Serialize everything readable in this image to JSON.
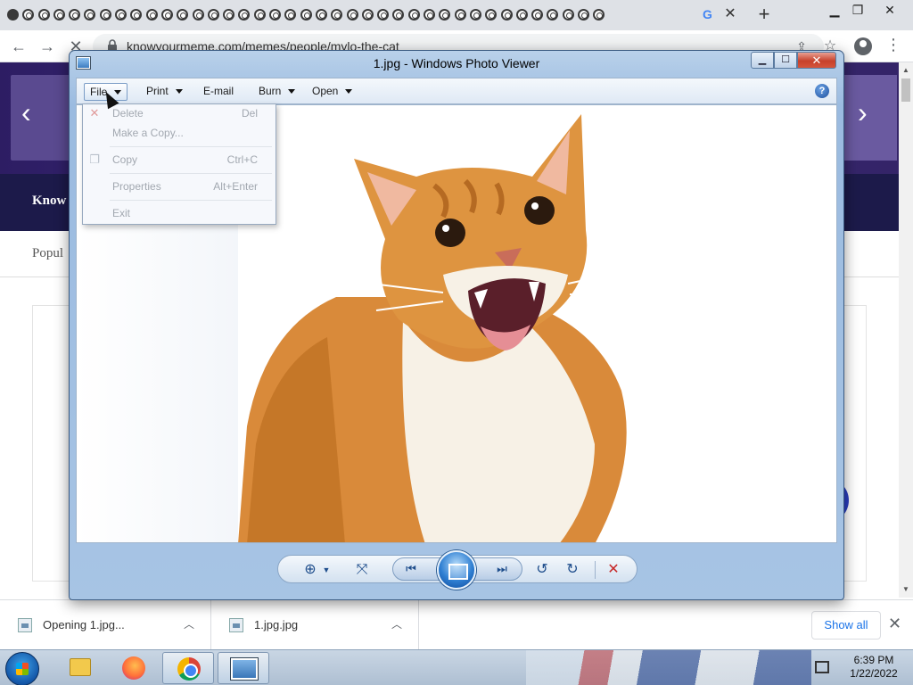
{
  "browser": {
    "url": "knowyourmeme.com/memes/people/mylo-the-cat",
    "tab_count_visible": 39
  },
  "website": {
    "nav_label": "Know",
    "section_label": "Popul"
  },
  "downloads": {
    "items": [
      {
        "name": "Opening 1.jpg..."
      },
      {
        "name": "1.jpg.jpg"
      }
    ],
    "show_all_label": "Show all"
  },
  "photo_viewer": {
    "title": "1.jpg - Windows Photo Viewer",
    "menus": [
      {
        "label": "File"
      },
      {
        "label": "Print"
      },
      {
        "label": "E-mail"
      },
      {
        "label": "Burn"
      },
      {
        "label": "Open"
      }
    ],
    "help_glyph": "?",
    "file_menu": {
      "items": [
        {
          "label": "Delete",
          "shortcut": "Del",
          "icon": "delete-x-icon"
        },
        {
          "label": "Make a Copy...",
          "shortcut": ""
        },
        {
          "label": "Copy",
          "shortcut": "Ctrl+C",
          "icon": "copy-icon"
        },
        {
          "label": "Properties",
          "shortcut": "Alt+Enter"
        },
        {
          "label": "Exit",
          "shortcut": ""
        }
      ]
    },
    "image_file": "1.jpg"
  },
  "taskbar": {
    "time": "6:39 PM",
    "date": "1/22/2022"
  },
  "colors": {
    "site_banner": "#2d1d63",
    "site_nav": "#1c1a4a",
    "accent_blue": "#1a73e8",
    "cat_orange": "#d98a3a"
  }
}
